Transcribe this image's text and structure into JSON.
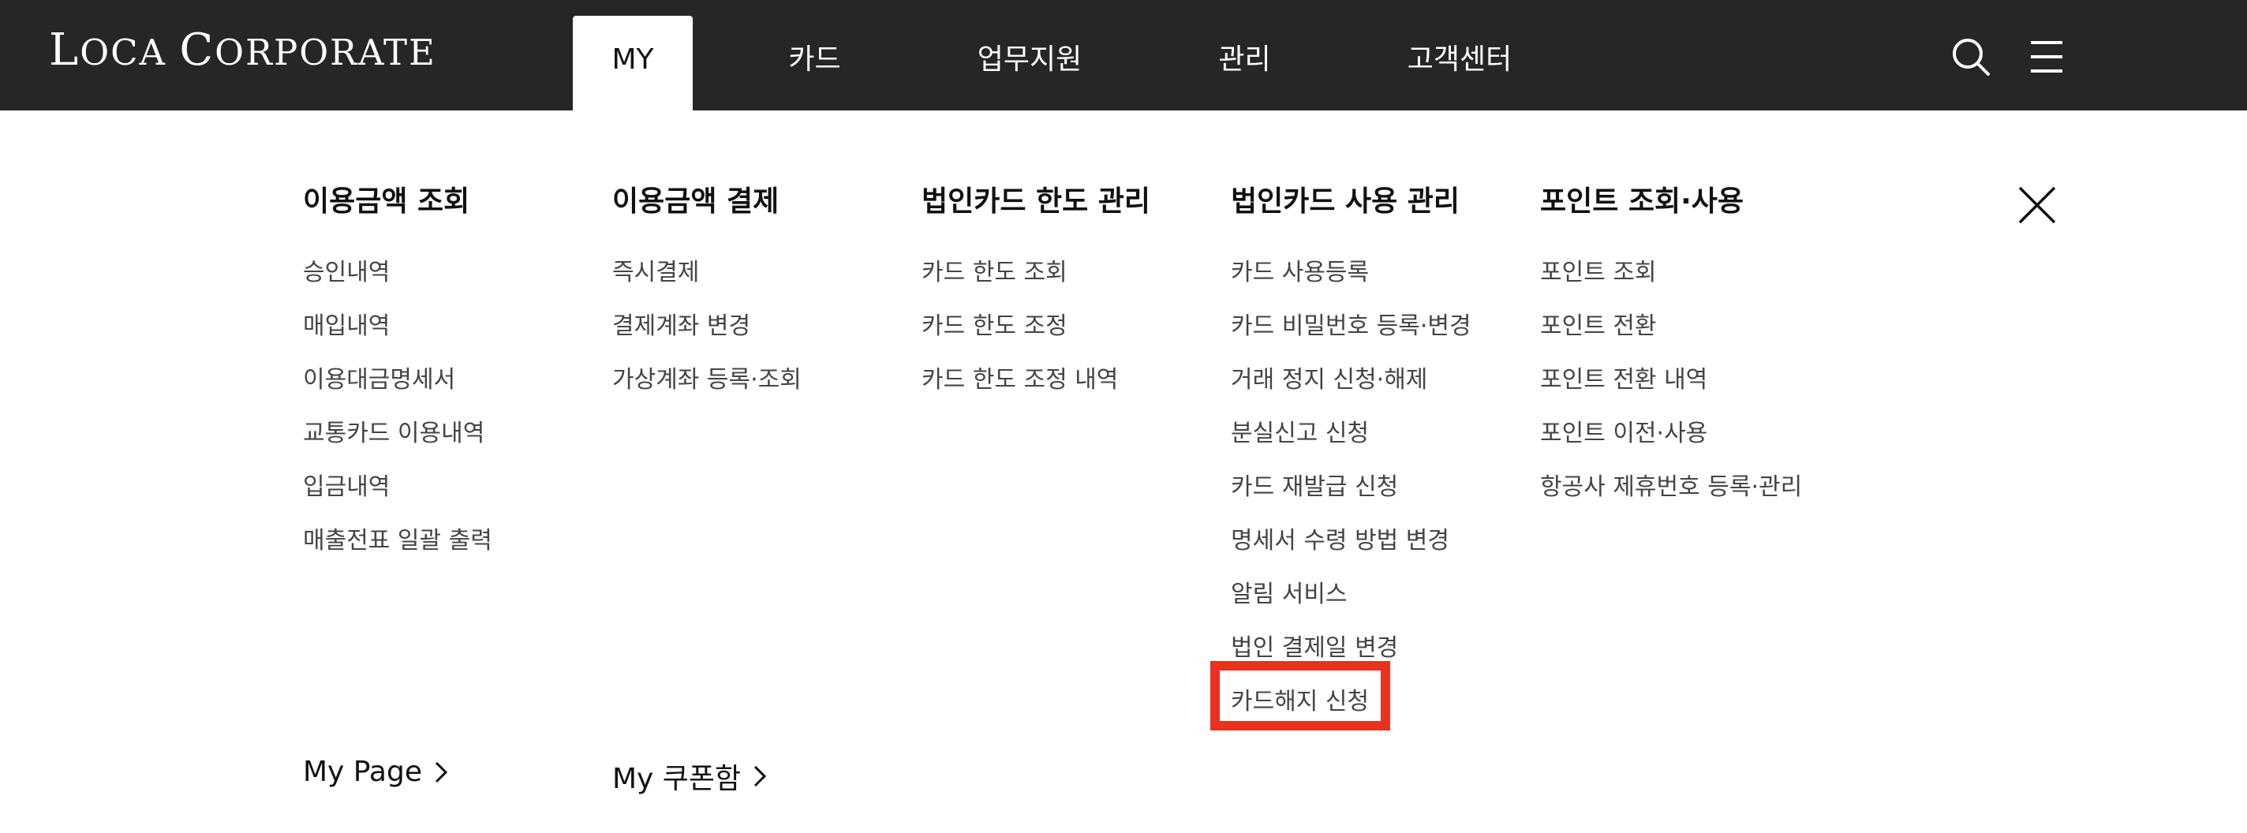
{
  "brand": {
    "logo_first_initial": "L",
    "logo_first_rest": "OCA ",
    "logo_second_initial": "C",
    "logo_second_rest": "ORPORATE"
  },
  "nav": {
    "tabs": [
      {
        "label": "MY",
        "active": true
      },
      {
        "label": "카드"
      },
      {
        "label": "업무지원"
      },
      {
        "label": "관리"
      },
      {
        "label": "고객센터"
      }
    ]
  },
  "icons": {
    "search": "search-icon",
    "menu": "hamburger-menu-icon",
    "close": "close-icon",
    "chevron": "chevron-right-icon"
  },
  "menu": {
    "columns": [
      {
        "title": "이용금액 조회",
        "items": [
          "승인내역",
          "매입내역",
          "이용대금명세서",
          "교통카드 이용내역",
          "입금내역",
          "매출전표 일괄 출력"
        ]
      },
      {
        "title": "이용금액 결제",
        "items": [
          "즉시결제",
          "결제계좌 변경",
          "가상계좌 등록·조회"
        ]
      },
      {
        "title": "법인카드 한도 관리",
        "items": [
          "카드 한도 조회",
          "카드 한도 조정",
          "카드 한도 조정 내역"
        ]
      },
      {
        "title": "법인카드 사용 관리",
        "items": [
          "카드 사용등록",
          "카드 비밀번호 등록·변경",
          "거래 정지 신청·해제",
          "분실신고 신청",
          "카드 재발급 신청",
          "명세서 수령 방법 변경",
          "알림 서비스",
          "법인 결제일 변경",
          "카드해지 신청"
        ]
      },
      {
        "title": "포인트 조회·사용",
        "items": [
          "포인트 조회",
          "포인트 전환",
          "포인트 전환 내역",
          "포인트 이전·사용",
          "항공사 제휴번호 등록·관리"
        ]
      }
    ]
  },
  "bottom_links": {
    "my_page": "My Page",
    "my_coupon": "My 쿠폰함"
  },
  "colors": {
    "topbar": "#262626",
    "highlight": "#e8321f"
  }
}
